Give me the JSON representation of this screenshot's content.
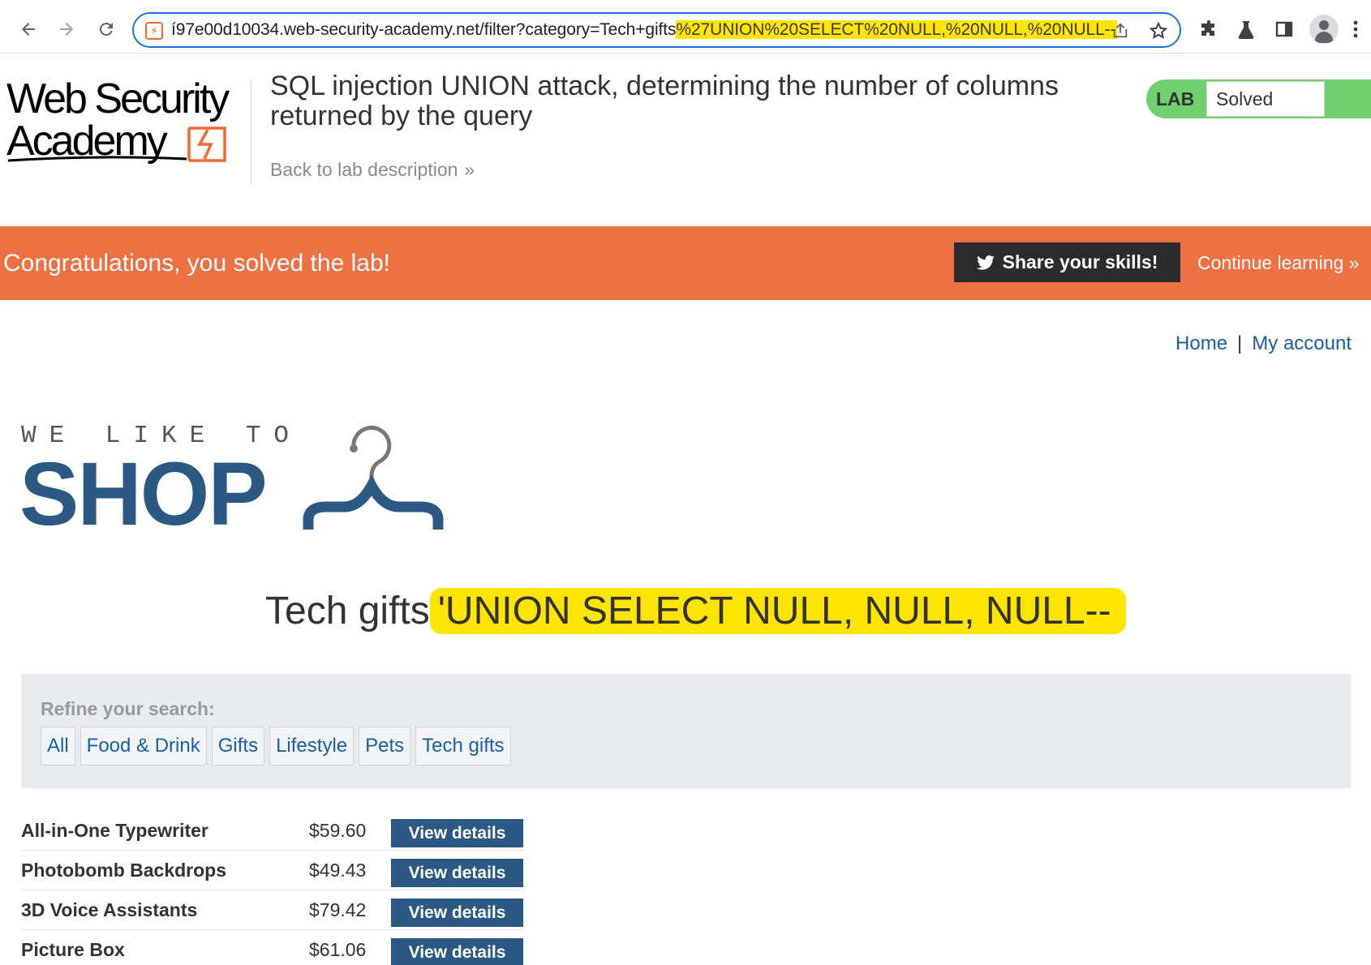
{
  "browser": {
    "url_main": "í97e00d10034.web-security-academy.net/filter?category=Tech+gifts",
    "url_highlight": "%27UNION%20SELECT%20NULL,%20NULL,%20NULL--",
    "back_icon": "arrow-left-icon",
    "forward_icon": "arrow-right-icon",
    "reload_icon": "reload-icon"
  },
  "academy": {
    "logo_line1": "Web Security",
    "logo_line2": "Academy",
    "lab_title": "SQL injection UNION attack, determining the number of columns returned by the query",
    "back_link": "Back to lab description",
    "back_chevron": "»",
    "status_label": "LAB",
    "status_value": "Solved",
    "status_color": "#70d16e"
  },
  "banner": {
    "message": "Congratulations, you solved the lab!",
    "share_label": "Share your skills!",
    "continue_label": "Continue learning »",
    "color": "#ed7142"
  },
  "shop": {
    "home_link": "Home",
    "link_separator": "|",
    "account_link": "My account",
    "logo_tagline": "WE LIKE TO",
    "logo_word": "SHOP",
    "heading_main": "Tech gifts",
    "heading_injection": "'UNION SELECT NULL, NULL, NULL--",
    "refine_label": "Refine your search:",
    "filters": [
      "All",
      "Food & Drink",
      "Gifts",
      "Lifestyle",
      "Pets",
      "Tech gifts"
    ],
    "brand_color": "#2b5983",
    "products": [
      {
        "name": "All-in-One Typewriter",
        "price": "$59.60",
        "button": "View details"
      },
      {
        "name": "Photobomb Backdrops",
        "price": "$49.43",
        "button": "View details"
      },
      {
        "name": "3D Voice Assistants",
        "price": "$79.42",
        "button": "View details"
      },
      {
        "name": "Picture Box",
        "price": "$61.06",
        "button": "View details"
      }
    ]
  }
}
